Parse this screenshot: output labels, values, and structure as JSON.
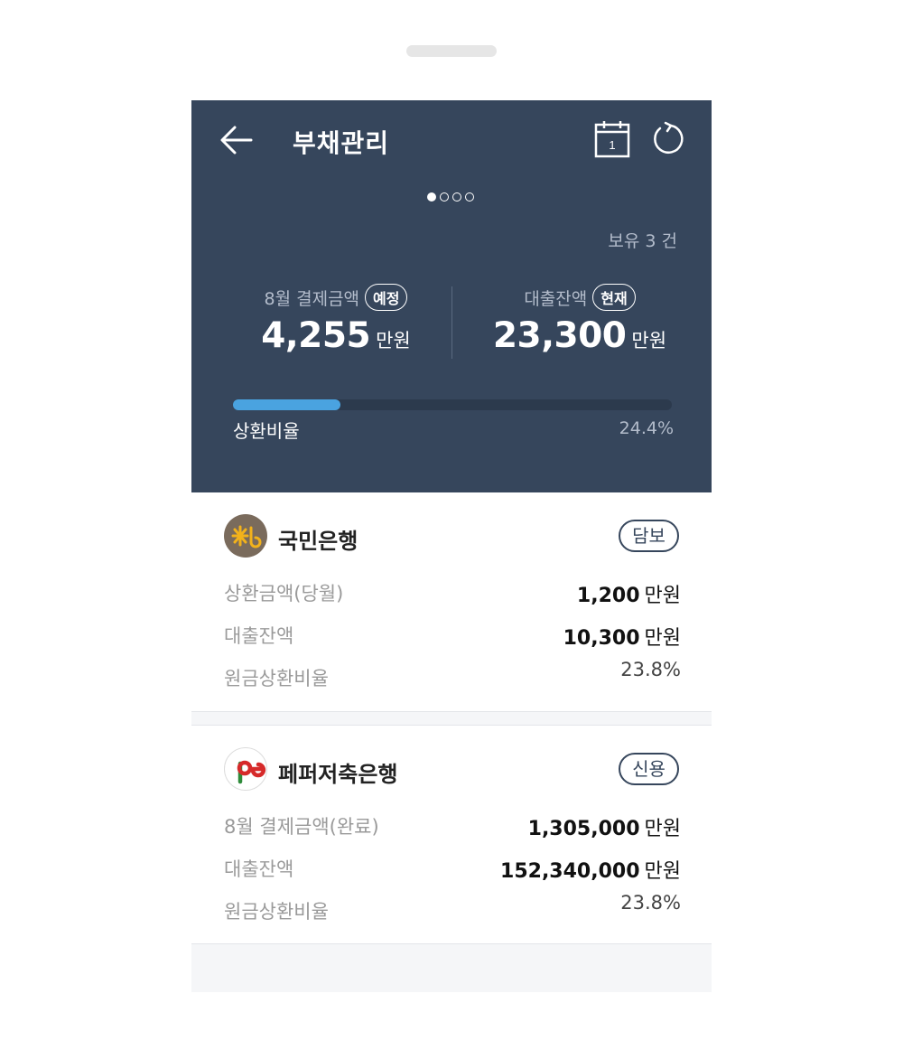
{
  "header": {
    "title": "부채관리",
    "calendar_day": "1",
    "holding": "보유 3 건",
    "payment": {
      "label": "8월 결제금액",
      "badge": "예정",
      "value": "4,255",
      "unit": "만원"
    },
    "balance": {
      "label": "대출잔액",
      "badge": "현재",
      "value": "23,300",
      "unit": "만원"
    },
    "repayment": {
      "label": "상환비율",
      "percent_text": "24.4%",
      "percent": 24.4
    }
  },
  "pager": {
    "total": 4,
    "active": 0
  },
  "loans": [
    {
      "bank": "국민은행",
      "type": "담보",
      "rows": [
        {
          "label": "상환금액(당월)",
          "value": "1,200",
          "unit": "만원"
        },
        {
          "label": "대출잔액",
          "value": "10,300",
          "unit": "만원"
        },
        {
          "label": "원금상환비율",
          "plain": "23.8%"
        }
      ]
    },
    {
      "bank": "페퍼저축은행",
      "type": "신용",
      "rows": [
        {
          "label": "8월 결제금액(완료)",
          "value": "1,305,000",
          "unit": "만원"
        },
        {
          "label": "대출잔액",
          "value": "152,340,000",
          "unit": "만원"
        },
        {
          "label": "원금상환비율",
          "plain": "23.8%"
        }
      ]
    }
  ],
  "colors": {
    "header_bg": "#36465c",
    "progress": "#4aa3e0",
    "kb_logo_bg": "#7a6b5c",
    "kb_star": "#f2b21b"
  }
}
